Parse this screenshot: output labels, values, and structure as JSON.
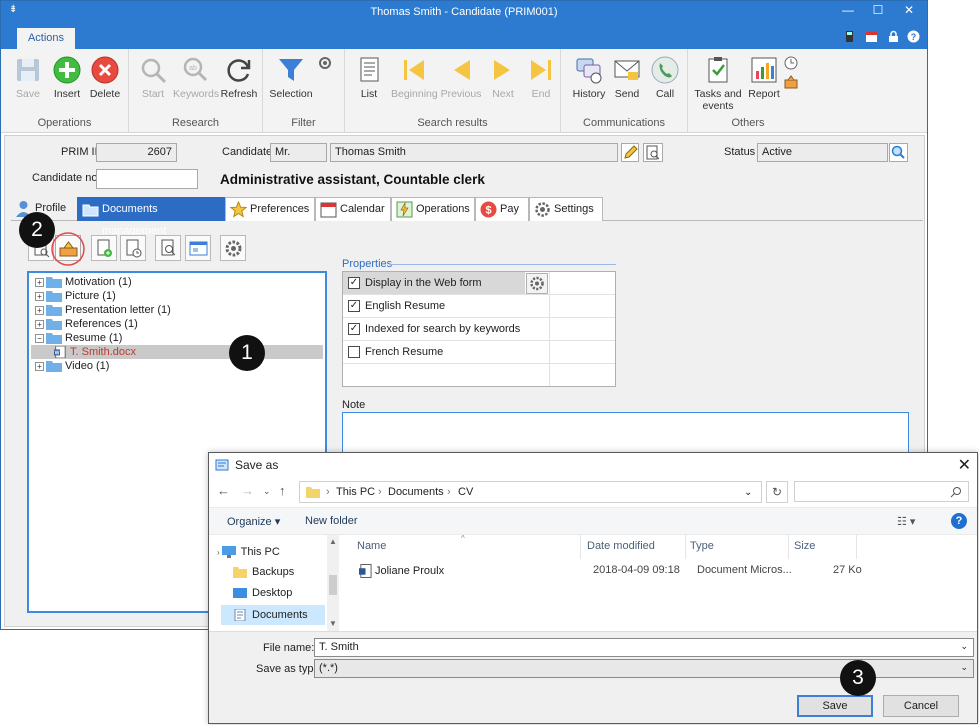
{
  "window": {
    "title": "Thomas Smith - Candidate (PRIM001)",
    "sys_glyph": "⇟",
    "min": "—",
    "max": "☐",
    "close": "✕"
  },
  "ribbon": {
    "tab": "Actions",
    "groups": {
      "operations": {
        "label": "Operations",
        "save": "Save",
        "insert": "Insert",
        "delete": "Delete"
      },
      "research": {
        "label": "Research",
        "start": "Start",
        "keywords": "Keywords",
        "refresh": "Refresh"
      },
      "filter": {
        "label": "Filter",
        "selection": "Selection"
      },
      "search_results": {
        "label": "Search results",
        "list": "List",
        "beginning": "Beginning",
        "previous": "Previous",
        "next": "Next",
        "end": "End"
      },
      "communications": {
        "label": "Communications",
        "history": "History",
        "send": "Send",
        "call": "Call"
      },
      "others": {
        "label": "Others",
        "tasks": "Tasks and events",
        "report": "Report"
      }
    }
  },
  "record": {
    "prim_id_label": "PRIM ID",
    "prim_id": "2607",
    "candidate_label": "Candidate",
    "title_prefix": "Mr.",
    "candidate_name": "Thomas Smith",
    "status_label": "Status",
    "status": "Active",
    "candidate_no_label": "Candidate no.",
    "candidate_no": "",
    "headline": "Administrative assistant, Countable clerk"
  },
  "tabs": [
    "Profile",
    "Documents management",
    "Preferences",
    "Calendar",
    "Operations",
    "Pay",
    "Settings"
  ],
  "tree": {
    "nodes": [
      {
        "label": "Motivation (1)"
      },
      {
        "label": "Picture (1)"
      },
      {
        "label": "Presentation letter (1)"
      },
      {
        "label": "References (1)"
      },
      {
        "label": "Resume (1)"
      },
      {
        "label": "T. Smith.docx"
      },
      {
        "label": "Video (1)"
      }
    ]
  },
  "properties": {
    "legend": "Properties",
    "rows": [
      {
        "label": "Display in the Web form",
        "checked": "✓"
      },
      {
        "label": "English Resume",
        "checked": "✓"
      },
      {
        "label": "Indexed for search by keywords",
        "checked": "✓"
      },
      {
        "label": "French Resume",
        "checked": ""
      }
    ]
  },
  "note": {
    "label": "Note"
  },
  "callouts": {
    "one": "1",
    "two": "2",
    "three": "3"
  },
  "dialog": {
    "title": "Save as",
    "close": "✕",
    "path": [
      "This PC",
      "CV",
      "Documents"
    ],
    "organize": "Organize ▾",
    "new_folder": "New folder",
    "nav": [
      "This PC",
      "Backups",
      "Desktop",
      "Documents"
    ],
    "columns": [
      "Name",
      "Date modified",
      "Type",
      "Size"
    ],
    "files": [
      {
        "name": "Joliane Proulx",
        "date": "2018-04-09 09:18",
        "type": "Document Micros...",
        "size": "27 Ko"
      }
    ],
    "file_name_label": "File name:",
    "file_name": "T. Smith",
    "save_type_label": "Save as type:",
    "save_type": "(*.*)",
    "save": "Save",
    "cancel": "Cancel"
  },
  "colors": {
    "accent": "#2d7bd1",
    "tab_active": "#2d6cc4",
    "callout": "#111111",
    "selected_file": "#c0392b"
  }
}
